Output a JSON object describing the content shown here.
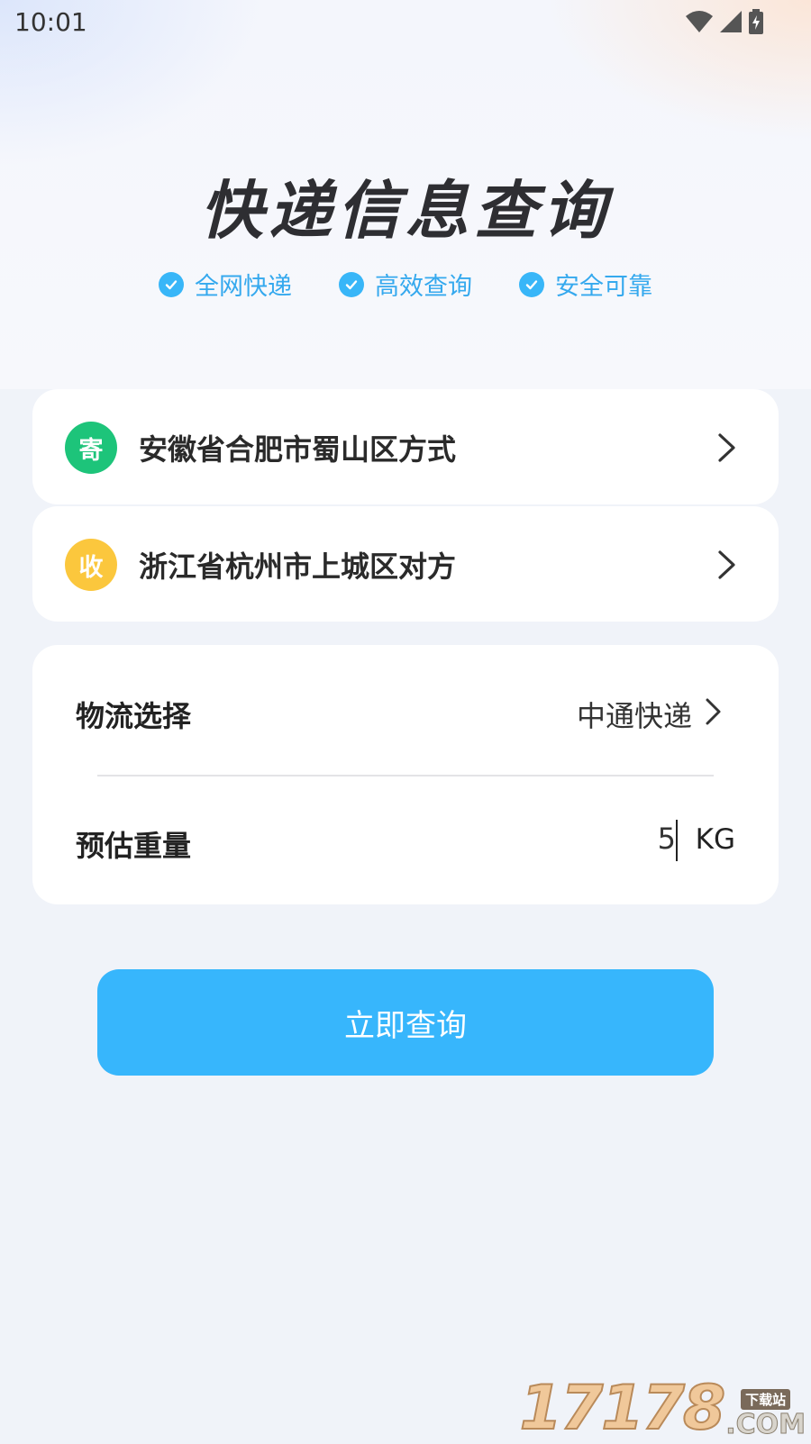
{
  "status_bar": {
    "time": "10:01"
  },
  "header": {
    "title": "快递信息查询",
    "features": [
      {
        "label": "全网快递"
      },
      {
        "label": "高效查询"
      },
      {
        "label": "安全可靠"
      }
    ]
  },
  "sender": {
    "badge": "寄",
    "address": "安徽省合肥市蜀山区方式",
    "badge_color": "#1dc47a"
  },
  "receiver": {
    "badge": "收",
    "address": "浙江省杭州市上城区对方",
    "badge_color": "#fbc73d"
  },
  "options": {
    "carrier_label": "物流选择",
    "carrier_value": "中通快递",
    "weight_label": "预估重量",
    "weight_value": "5",
    "weight_unit": "KG"
  },
  "actions": {
    "query_label": "立即查询",
    "accent": "#37b6fc"
  },
  "watermark": {
    "number": "17178",
    "tag": "下载站",
    "suffix": ".COM"
  }
}
